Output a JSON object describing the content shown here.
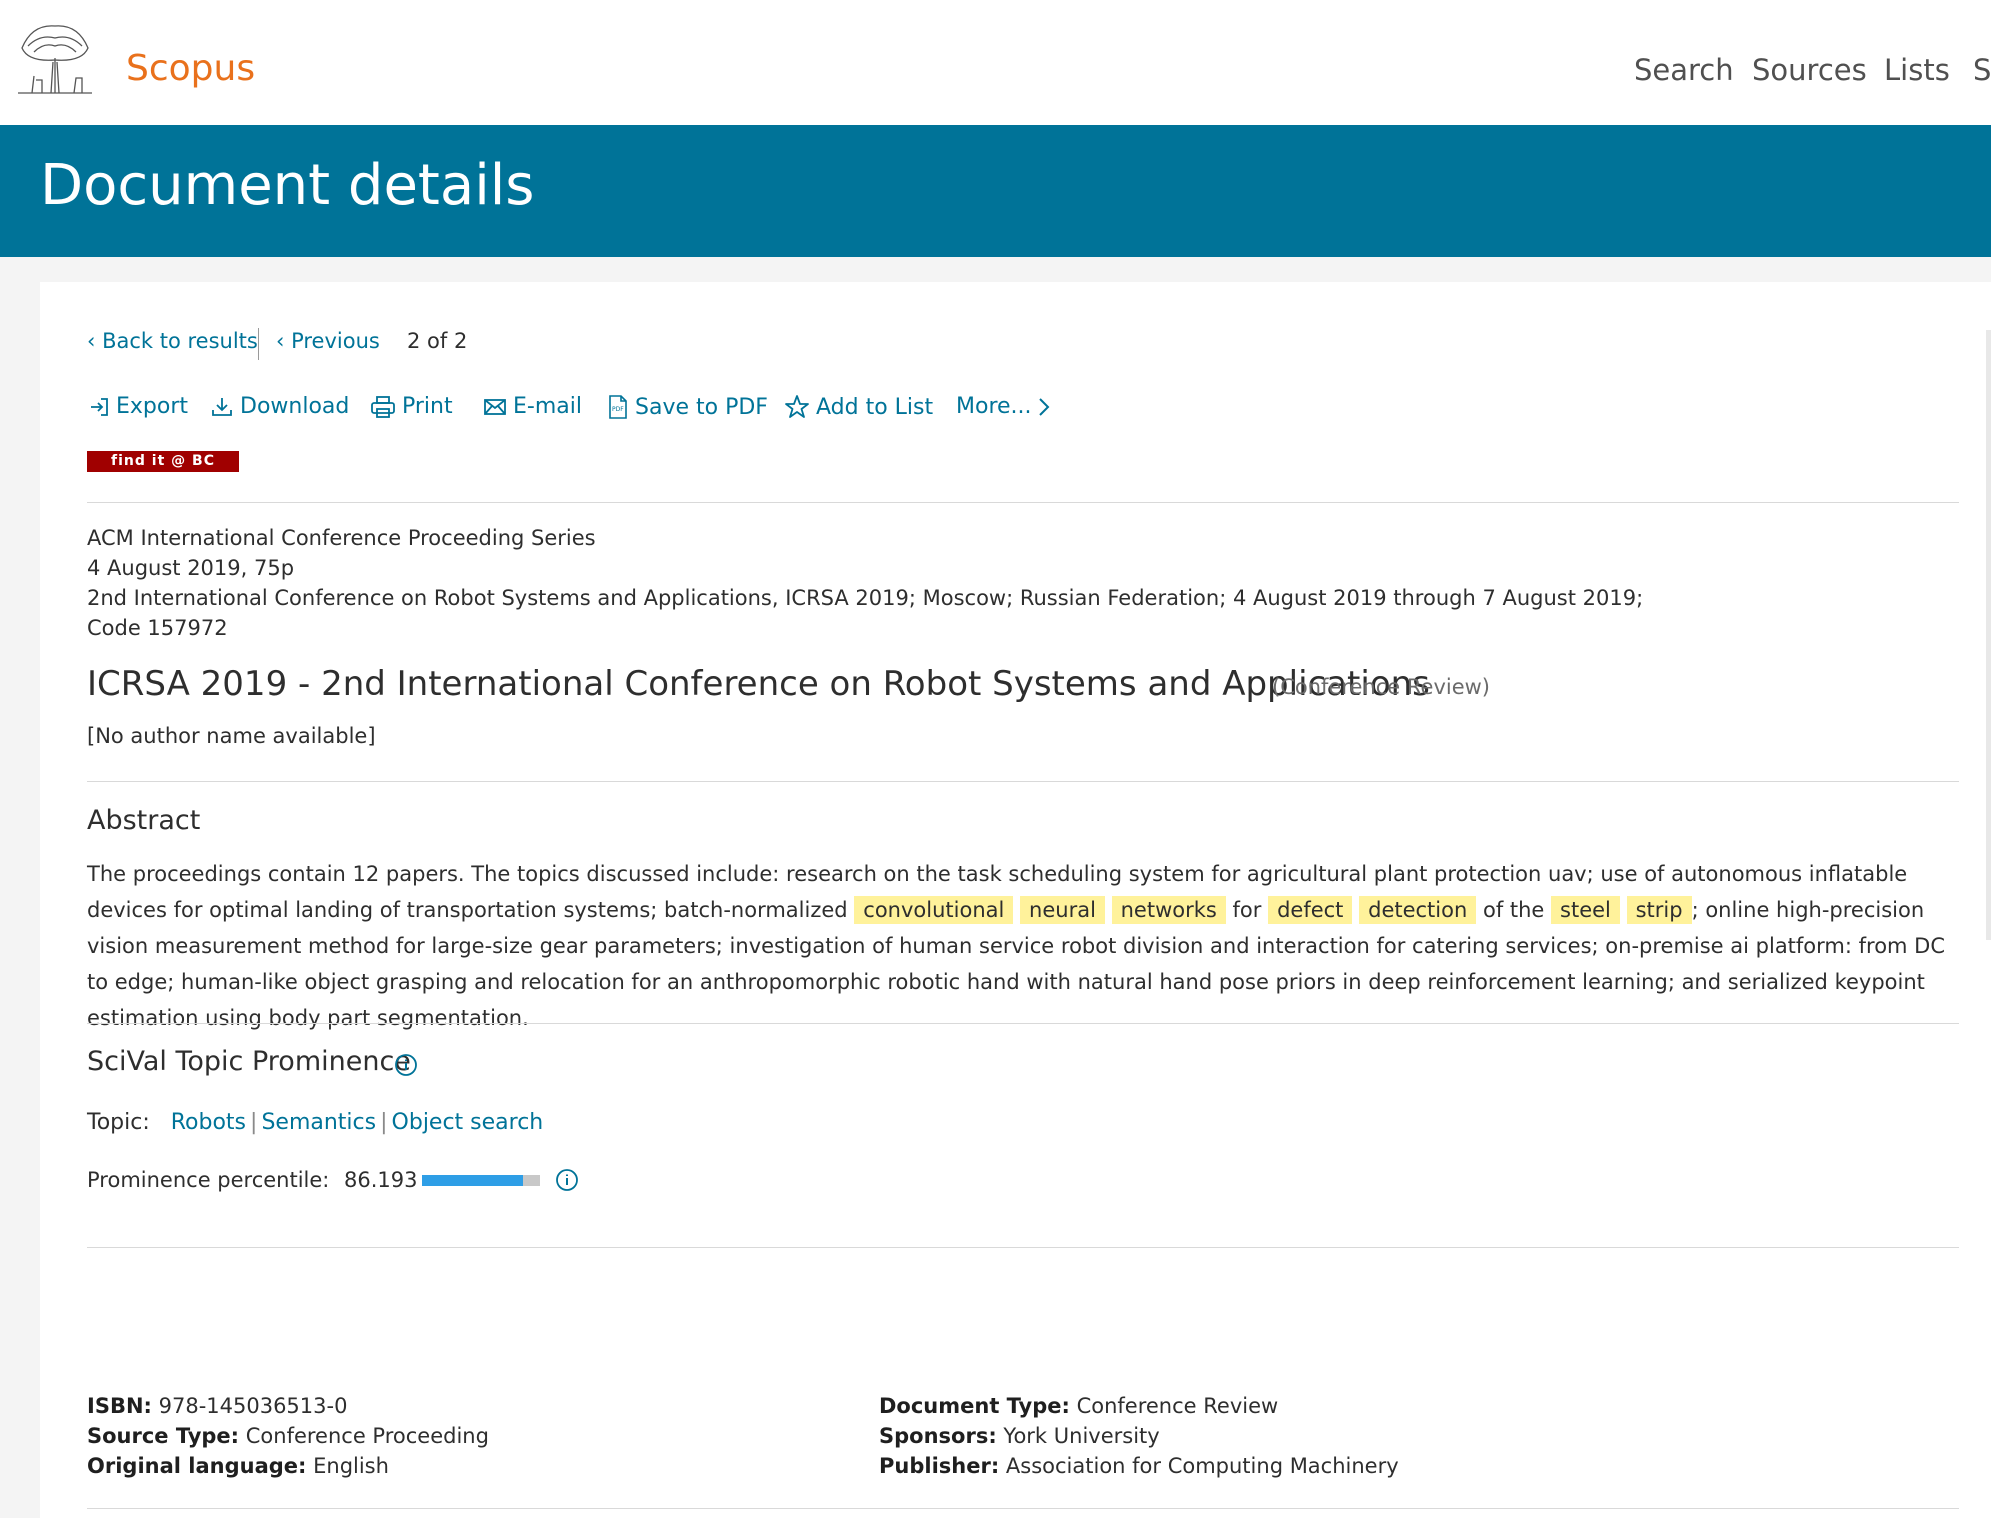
{
  "header": {
    "brand": "Scopus",
    "nav": [
      "Search",
      "Sources",
      "Lists",
      "Sc"
    ]
  },
  "page_title": "Document details",
  "results_nav": {
    "back": "Back to results",
    "previous": "Previous",
    "position": "2  of  2"
  },
  "actions": {
    "export": "Export",
    "download": "Download",
    "print": "Print",
    "email": "E-mail",
    "save_pdf": "Save to PDF",
    "add_list": "Add to List",
    "more": "More..."
  },
  "findit_label": "find it @ BC",
  "source": {
    "series": "ACM International Conference Proceeding Series",
    "date_pages": "4 August 2019, 75p",
    "conference": "2nd International Conference on Robot Systems and Applications, ICRSA 2019; Moscow; Russian Federation; 4 August 2019 through 7 August 2019;",
    "code": "Code 157972"
  },
  "document": {
    "title": "ICRSA 2019 - 2nd International Conference on Robot Systems and Applications",
    "type": "(Conference Review)",
    "authors": "[No author name available]"
  },
  "abstract": {
    "heading": "Abstract",
    "text_1": "The proceedings contain 12 papers. The topics discussed include: research on the task scheduling system for agricultural plant protection uav; use of autonomous inflatable devices for optimal landing of transportation systems; batch-normalized ",
    "highlight_1": "convolutional",
    "highlight_2": "neural",
    "highlight_3": "networks",
    "word_for": " for ",
    "highlight_4": "defect",
    "highlight_5": "detection",
    "word_of_the": " of the ",
    "highlight_6": "steel",
    "highlight_7": "strip",
    "text_2": "; online high-precision vision measurement method for large-size gear parameters; investigation of human service robot division and interaction for catering services; on-premise ai platform: from DC to edge; human-like object grasping and relocation for an anthropomorphic robotic hand with natural hand pose priors in deep reinforcement learning; and serialized keypoint estimation using body part segmentation."
  },
  "scival": {
    "heading": "SciVal Topic Prominence",
    "topic_label": "Topic:",
    "topics": [
      "Robots",
      "Semantics",
      "Object search"
    ],
    "prominence_label": "Prominence percentile:",
    "prominence_value": "86.193",
    "prominence_fraction": 0.86
  },
  "bibliographic": {
    "isbn_label": "ISBN:",
    "isbn": "978-145036513-0",
    "source_type_label": "Source Type:",
    "source_type": "Conference Proceeding",
    "language_label": "Original language:",
    "language": "English",
    "doc_type_label": "Document Type:",
    "doc_type": "Conference Review",
    "sponsors_label": "Sponsors:",
    "sponsors": "York University",
    "publisher_label": "Publisher:",
    "publisher": "Association for Computing Machinery"
  },
  "colors": {
    "brand": "#e9711c",
    "hero": "#007398",
    "link": "#007398",
    "highlight": "#fff29b",
    "prominence_bar": "#2e9ee6",
    "findit_badge": "#a00000"
  }
}
